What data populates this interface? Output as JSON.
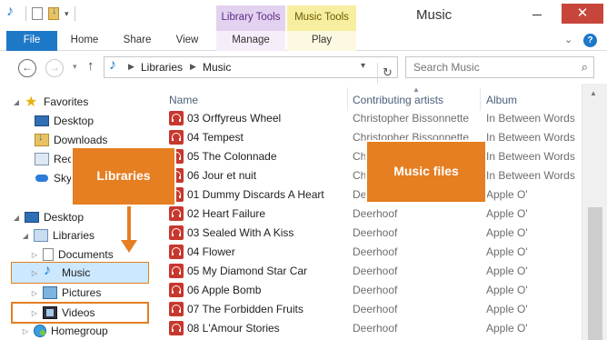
{
  "window": {
    "title": "Music",
    "close_glyph": "✕",
    "context_tabs": {
      "library_tools": "Library Tools",
      "music_tools": "Music Tools"
    }
  },
  "ribbon": {
    "tabs": [
      "File",
      "Home",
      "Share",
      "View",
      "Manage",
      "Play"
    ],
    "help_glyph": "?"
  },
  "address": {
    "crumbs": [
      "Libraries",
      "Music"
    ],
    "search_placeholder": "Search Music"
  },
  "nav": {
    "favorites": "Favorites",
    "desktop": "Desktop",
    "downloads": "Downloads",
    "recent": "Rec",
    "skydrive": "Sky",
    "desktop2": "Desktop",
    "libraries": "Libraries",
    "documents": "Documents",
    "music": "Music",
    "pictures": "Pictures",
    "videos": "Videos",
    "homegroup": "Homegroup"
  },
  "columns": {
    "name": "Name",
    "artist": "Contributing artists",
    "album": "Album"
  },
  "files": [
    {
      "name": "03 Orffyreus Wheel",
      "artist": "Christopher Bissonnette",
      "album": "In Between Words"
    },
    {
      "name": "04 Tempest",
      "artist": "Christopher Bissonnette",
      "album": "In Between Words"
    },
    {
      "name": "05 The Colonnade",
      "artist": "Ch",
      "album": "In Between Words"
    },
    {
      "name": "06 Jour et nuit",
      "artist": "Ch",
      "album": "In Between Words"
    },
    {
      "name": "01 Dummy Discards A Heart",
      "artist": "De",
      "album": "Apple O'"
    },
    {
      "name": "02 Heart Failure",
      "artist": "Deerhoof",
      "album": "Apple O'"
    },
    {
      "name": "03 Sealed With A Kiss",
      "artist": "Deerhoof",
      "album": "Apple O'"
    },
    {
      "name": "04 Flower",
      "artist": "Deerhoof",
      "album": "Apple O'"
    },
    {
      "name": "05 My Diamond Star Car",
      "artist": "Deerhoof",
      "album": "Apple O'"
    },
    {
      "name": "06 Apple Bomb",
      "artist": "Deerhoof",
      "album": "Apple O'"
    },
    {
      "name": "07 The Forbidden Fruits",
      "artist": "Deerhoof",
      "album": "Apple O'"
    },
    {
      "name": "08 L'Amour Stories",
      "artist": "Deerhoof",
      "album": "Apple O'"
    }
  ],
  "callouts": {
    "libraries": "Libraries",
    "music_files": "Music files"
  },
  "colors": {
    "accent": "#1e78c8",
    "callout": "#e67e22",
    "close": "#c7453a"
  }
}
